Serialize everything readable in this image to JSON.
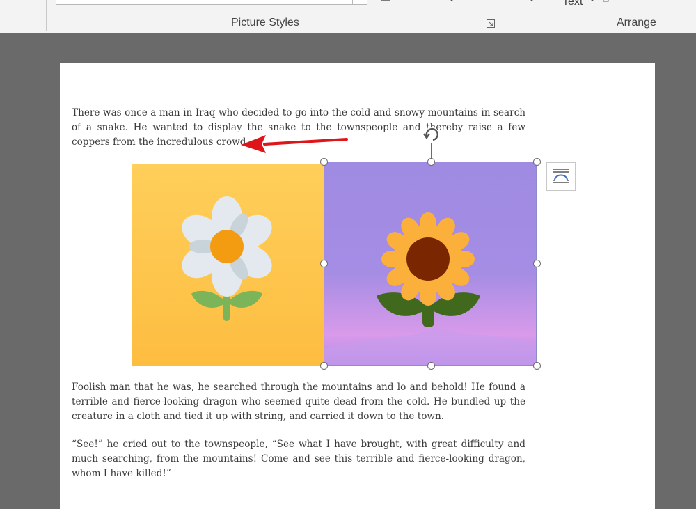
{
  "ribbon": {
    "partial_top_text": "Text",
    "groups": [
      {
        "label": "Picture Styles"
      },
      {
        "label": "Arrange"
      }
    ]
  },
  "document": {
    "paragraphs": [
      "There was once a man in Iraq who decided to go into the cold and snowy mountains in search of a snake. He wanted to display the snake to the townspeople and thereby raise a few coppers from the incredulous crowd.",
      "Foolish man that he was, he searched through the mountains and lo and behold! He found a terrible and fierce-looking dragon who seemed quite dead from the cold. He bundled up the creature in a cloth and tied it up with string, and carried it down to the town.",
      "“See!” he cried out to the townspeople, “See what I have brought, with great difficulty and much searching, from the mountains! Come and see this terrible and fierce-looking dragon, whom I have killed!”"
    ],
    "images": [
      {
        "icon": "white-flower-icon",
        "background": "#fdc94f",
        "accent": "#f39c12"
      },
      {
        "icon": "sunflower-icon",
        "background": "#a58be3",
        "accent": "#fbb03b",
        "selected": true
      }
    ]
  },
  "colors": {
    "annotation_arrow": "#e0151a",
    "workspace": "#6a6a6a"
  }
}
